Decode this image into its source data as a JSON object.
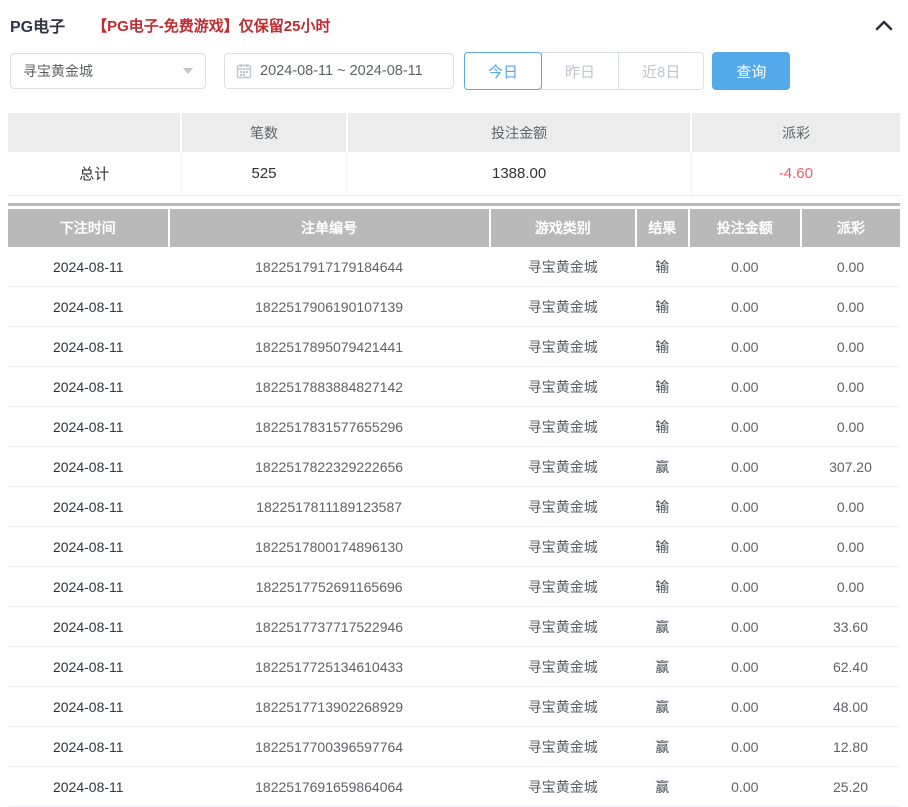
{
  "header": {
    "title": "PG电子",
    "notice": "【PG电子-免费游戏】仅保留25小时",
    "collapse_icon": "chevron-up"
  },
  "filters": {
    "game_select": {
      "value": "寻宝黄金城"
    },
    "date_range": {
      "value": "2024-08-11 ~ 2024-08-11",
      "icon": "calendar"
    },
    "quick_buttons": [
      {
        "label": "今日",
        "active": true
      },
      {
        "label": "昨日",
        "active": false
      },
      {
        "label": "近8日",
        "active": false
      }
    ],
    "search_label": "查询"
  },
  "summary": {
    "columns": [
      "",
      "笔数",
      "投注金额",
      "派彩"
    ],
    "row_label": "总计",
    "count": "525",
    "bet_amount": "1388.00",
    "payout": "-4.60"
  },
  "table": {
    "columns": [
      "下注时间",
      "注单编号",
      "游戏类别",
      "结果",
      "投注金额",
      "派彩"
    ],
    "rows": [
      [
        "2024-08-11",
        "1822517917179184644",
        "寻宝黄金城",
        "输",
        "0.00",
        "0.00"
      ],
      [
        "2024-08-11",
        "1822517906190107139",
        "寻宝黄金城",
        "输",
        "0.00",
        "0.00"
      ],
      [
        "2024-08-11",
        "1822517895079421441",
        "寻宝黄金城",
        "输",
        "0.00",
        "0.00"
      ],
      [
        "2024-08-11",
        "1822517883884827142",
        "寻宝黄金城",
        "输",
        "0.00",
        "0.00"
      ],
      [
        "2024-08-11",
        "1822517831577655296",
        "寻宝黄金城",
        "输",
        "0.00",
        "0.00"
      ],
      [
        "2024-08-11",
        "1822517822329222656",
        "寻宝黄金城",
        "赢",
        "0.00",
        "307.20"
      ],
      [
        "2024-08-11",
        "1822517811189123587",
        "寻宝黄金城",
        "输",
        "0.00",
        "0.00"
      ],
      [
        "2024-08-11",
        "1822517800174896130",
        "寻宝黄金城",
        "输",
        "0.00",
        "0.00"
      ],
      [
        "2024-08-11",
        "1822517752691165696",
        "寻宝黄金城",
        "输",
        "0.00",
        "0.00"
      ],
      [
        "2024-08-11",
        "1822517737717522946",
        "寻宝黄金城",
        "赢",
        "0.00",
        "33.60"
      ],
      [
        "2024-08-11",
        "1822517725134610433",
        "寻宝黄金城",
        "赢",
        "0.00",
        "62.40"
      ],
      [
        "2024-08-11",
        "1822517713902268929",
        "寻宝黄金城",
        "赢",
        "0.00",
        "48.00"
      ],
      [
        "2024-08-11",
        "1822517700396597764",
        "寻宝黄金城",
        "赢",
        "0.00",
        "12.80"
      ],
      [
        "2024-08-11",
        "1822517691659864064",
        "寻宝黄金城",
        "赢",
        "0.00",
        "25.20"
      ]
    ]
  },
  "colors": {
    "accent_blue": "#54a9ea",
    "negative_red": "#ef5e68",
    "notice_red": "#c12c31",
    "table_header_gray": "#b9b9b9",
    "summary_header_gray": "#ececec"
  }
}
